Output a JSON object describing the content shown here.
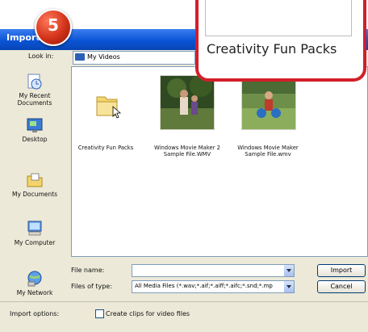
{
  "window": {
    "title": "Import"
  },
  "step_badge": "5",
  "callout": {
    "text": "Creativity Fun Packs"
  },
  "look_in": {
    "label": "Look in:",
    "value": "My Videos"
  },
  "places": [
    {
      "label": "My Recent Documents",
      "icon": "recent-documents-icon"
    },
    {
      "label": "Desktop",
      "icon": "desktop-icon"
    },
    {
      "label": "My Documents",
      "icon": "my-documents-icon"
    },
    {
      "label": "My Computer",
      "icon": "my-computer-icon"
    },
    {
      "label": "My Network",
      "icon": "my-network-icon"
    }
  ],
  "files": [
    {
      "name": "Creativity Fun Packs",
      "type": "folder"
    },
    {
      "name": "Windows Movie Maker 2 Sample File.WMV",
      "type": "video"
    },
    {
      "name": "Windows Movie Maker Sample File.wmv",
      "type": "video"
    }
  ],
  "file_name": {
    "label": "File name:",
    "value": ""
  },
  "files_of_type": {
    "label": "Files of type:",
    "value": "All Media Files (*.wav;*.aif;*.aiff;*.aifc;*.snd;*.mp"
  },
  "buttons": {
    "import": "Import",
    "cancel": "Cancel"
  },
  "import_options": {
    "label": "Import options:",
    "checkbox_label": "Create clips for video files",
    "checked": false
  },
  "colors": {
    "accent_red": "#d21f2a",
    "title_blue": "#0a54d6"
  }
}
